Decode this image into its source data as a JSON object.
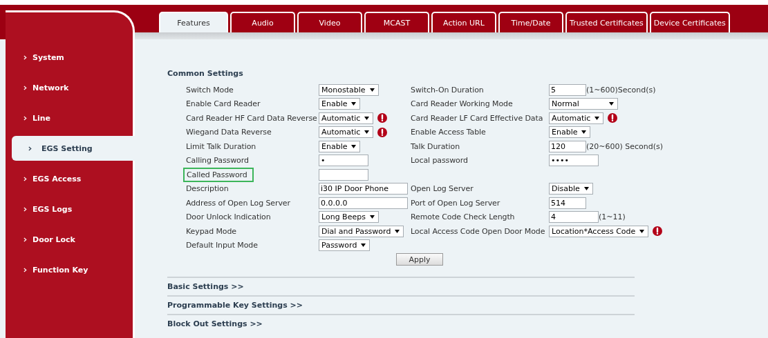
{
  "tabs": [
    {
      "label": "Features",
      "selected": true
    },
    {
      "label": "Audio",
      "selected": false
    },
    {
      "label": "Video",
      "selected": false
    },
    {
      "label": "MCAST",
      "selected": false
    },
    {
      "label": "Action URL",
      "selected": false
    },
    {
      "label": "Time/Date",
      "selected": false
    },
    {
      "label": "Trusted Certificates",
      "selected": false
    },
    {
      "label": "Device Certificates",
      "selected": false
    }
  ],
  "sidebar": {
    "items": [
      {
        "label": "System",
        "selected": false
      },
      {
        "label": "Network",
        "selected": false
      },
      {
        "label": "Line",
        "selected": false
      },
      {
        "label": "EGS Setting",
        "selected": true
      },
      {
        "label": "EGS Access",
        "selected": false
      },
      {
        "label": "EGS Logs",
        "selected": false
      },
      {
        "label": "Door Lock",
        "selected": false
      },
      {
        "label": "Function Key",
        "selected": false
      }
    ]
  },
  "common_settings": {
    "title": "Common Settings",
    "rows": [
      [
        {
          "label": "Switch Mode",
          "kind": "select",
          "value": "Monostable"
        },
        {
          "label": "Switch-On Duration",
          "kind": "narrowinput",
          "value": "5",
          "suffix": "(1~600)Second(s)"
        }
      ],
      [
        {
          "label": "Enable Card Reader",
          "kind": "select",
          "value": "Enable"
        },
        {
          "label": "Card Reader Working Mode",
          "kind": "wideselect",
          "value": "Normal"
        }
      ],
      [
        {
          "label": "Card Reader HF Card Data Reverse",
          "kind": "select",
          "value": "Automatic",
          "info": true
        },
        {
          "label": "Card Reader LF Card Effective Data",
          "kind": "select",
          "value": "Automatic",
          "info": true
        }
      ],
      [
        {
          "label": "Wiegand Data Reverse",
          "kind": "select",
          "value": "Automatic",
          "info": true
        },
        {
          "label": "Enable Access Table",
          "kind": "select",
          "value": "Enable"
        }
      ],
      [
        {
          "label": "Limit Talk Duration",
          "kind": "select",
          "value": "Enable"
        },
        {
          "label": "Talk Duration",
          "kind": "narrowinput",
          "value": "120",
          "suffix": "(20~600) Second(s)"
        }
      ],
      [
        {
          "label": "Calling Password",
          "kind": "input",
          "value": "•"
        },
        {
          "label": "Local password",
          "kind": "input",
          "value": "••••"
        }
      ],
      [
        {
          "label": "Called Password",
          "kind": "input",
          "highlighted": true
        }
      ],
      [
        {
          "label": "Description",
          "kind": "wideinput",
          "value": "i30 IP Door Phone"
        },
        {
          "label": "Open Log Server",
          "kind": "select",
          "value": "Disable"
        }
      ],
      [
        {
          "label": "Address of Open Log Server",
          "kind": "wideinput",
          "value": "0.0.0.0"
        },
        {
          "label": "Port of Open Log Server",
          "kind": "narrowinput",
          "value": "514"
        }
      ],
      [
        {
          "label": "Door Unlock Indication",
          "kind": "select",
          "value": "Long Beeps"
        },
        {
          "label": "Remote Code Check Length",
          "kind": "input",
          "value": "4",
          "suffix": "(1~11)"
        }
      ],
      [
        {
          "label": "Keypad Mode",
          "kind": "select",
          "value": "Dial and Password"
        },
        {
          "label": "Local Access Code Open Door Mode",
          "kind": "select",
          "value": "Location*Access Code",
          "info": true
        }
      ],
      [
        {
          "label": "Default Input Mode",
          "kind": "select",
          "value": "Password"
        }
      ]
    ],
    "apply_button": "Apply"
  },
  "sections": [
    "Basic Settings >>",
    "Programmable Key Settings >>",
    "Block Out Settings >>"
  ]
}
